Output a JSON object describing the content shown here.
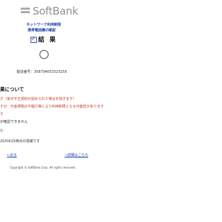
{
  "header": {
    "brand": "SoftBank",
    "subtitle_line1": "ネットワーク利用制限",
    "subtitle_line2": "携帯電話機の確認"
  },
  "result": {
    "title": "結 果",
    "device_number": "製造番号：358794053323255"
  },
  "section": {
    "title": "果について",
    "lines": [
      "す（後日不正契約が認められた場合を除きます）",
      "すが、代金債務の不履行等により利用制限となる可能性があります",
      "す",
      "が確認できません",
      "た"
    ],
    "date_note": "20/04/25時点の情報です"
  },
  "links": {
    "back": "←戻る",
    "details": "→詳細はこちら"
  },
  "footer": {
    "copyright": "Copyright © SoftBank Corp. All rights reserved."
  },
  "colors": {
    "brand_gray": "#8f8f8f",
    "link_blue": "#1a3ea8",
    "warning_red": "#c0392b"
  }
}
